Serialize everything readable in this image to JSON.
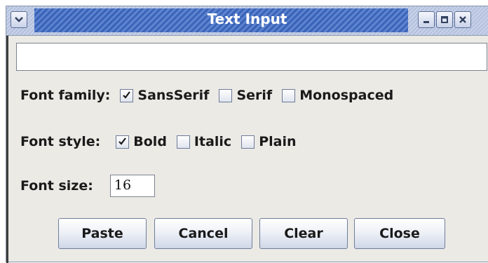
{
  "window": {
    "title": "Text Input"
  },
  "text_input": {
    "value": ""
  },
  "font_family": {
    "label": "Font family:",
    "options": [
      {
        "label": "SansSerif",
        "checked": true
      },
      {
        "label": "Serif",
        "checked": false
      },
      {
        "label": "Monospaced",
        "checked": false
      }
    ]
  },
  "font_style": {
    "label": "Font style:",
    "options": [
      {
        "label": "Bold",
        "checked": true
      },
      {
        "label": "Italic",
        "checked": false
      },
      {
        "label": "Plain",
        "checked": false
      }
    ]
  },
  "font_size": {
    "label": "Font size:",
    "value": "16"
  },
  "buttons": {
    "paste": "Paste",
    "cancel": "Cancel",
    "clear": "Clear",
    "close": "Close"
  },
  "colors": {
    "title_bar": "#3a64b8",
    "window_bg": "#ebeae5"
  },
  "icons": [
    "chevron-down-icon",
    "minimize-icon",
    "maximize-icon",
    "close-icon",
    "checkmark-icon"
  ]
}
